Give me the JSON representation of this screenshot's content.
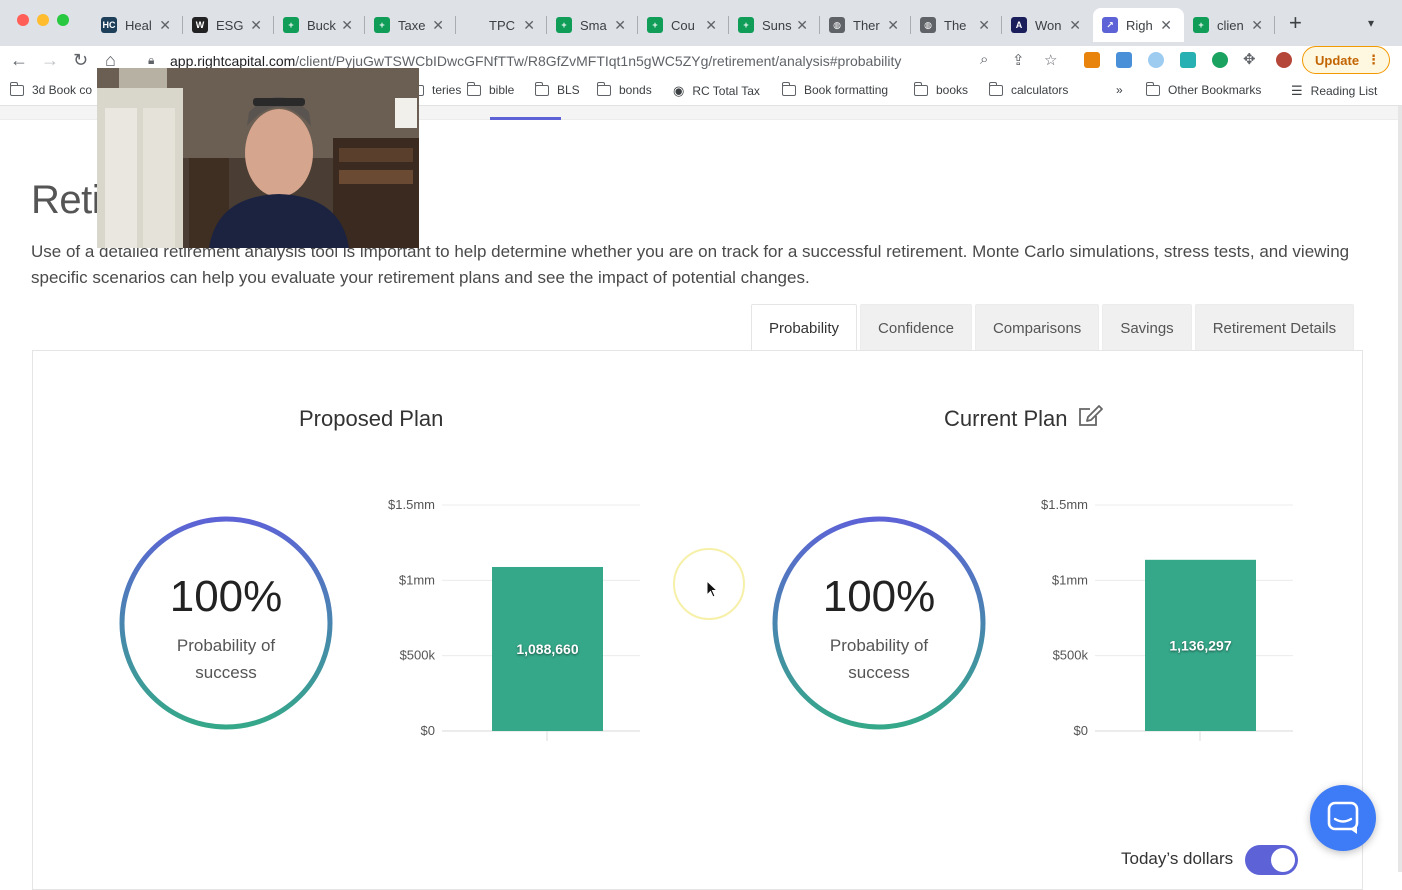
{
  "browser": {
    "tabs": [
      {
        "label": "Heal",
        "fav_text": "HC",
        "fav_color": "#1d3f5a"
      },
      {
        "label": "ESG",
        "fav_text": "W",
        "fav_color": "#222222"
      },
      {
        "label": "Buck",
        "fav_text": "+",
        "fav_color": "#0f9d58"
      },
      {
        "label": "Taxe",
        "fav_text": "+",
        "fav_color": "#0f9d58"
      },
      {
        "label": "TPC",
        "fav_text": "",
        "fav_color": "#dee1e6"
      },
      {
        "label": "Sma",
        "fav_text": "+",
        "fav_color": "#0f9d58"
      },
      {
        "label": "Cou",
        "fav_text": "+",
        "fav_color": "#0f9d58"
      },
      {
        "label": "Suns",
        "fav_text": "+",
        "fav_color": "#0f9d58"
      },
      {
        "label": "Ther",
        "fav_text": "◍",
        "fav_color": "#5f6368"
      },
      {
        "label": "The",
        "fav_text": "◍",
        "fav_color": "#5f6368"
      },
      {
        "label": "Won",
        "fav_text": "A",
        "fav_color": "#1a1f5c"
      },
      {
        "label": "Righ",
        "fav_text": "↗",
        "fav_color": "#5d63d6"
      },
      {
        "label": "clien",
        "fav_text": "+",
        "fav_color": "#0f9d58"
      }
    ],
    "active_tab_index": 11,
    "url_host": "app.rightcapital.com",
    "url_path": "/client/PyjuGwTSWCbIDwcGFNfTTw/R8GfZvMFTIqt1n5gWC5ZYg/retirement/analysis#probability",
    "update_label": "Update",
    "bookmarks": [
      {
        "label": "3d Book co",
        "type": "folder"
      },
      {
        "label": "teries",
        "type": "folder"
      },
      {
        "label": "bible",
        "type": "folder"
      },
      {
        "label": "BLS",
        "type": "folder"
      },
      {
        "label": "bonds",
        "type": "folder"
      },
      {
        "label": "RC Total Tax",
        "type": "globe"
      },
      {
        "label": "Book formatting",
        "type": "folder"
      },
      {
        "label": "books",
        "type": "folder"
      },
      {
        "label": "calculators",
        "type": "folder"
      },
      {
        "label": "»",
        "type": "overflow"
      },
      {
        "label": "Other Bookmarks",
        "type": "folder"
      },
      {
        "label": "Reading List",
        "type": "list"
      }
    ]
  },
  "page": {
    "title": "Reti",
    "description": "Use of a detailed retirement analysis tool is important to help determine whether you are on track for a successful retirement. Monte Carlo simulations, stress tests, and viewing specific scenarios can help you evaluate your retirement plans and see the impact of potential changes.",
    "tabs": [
      "Probability",
      "Confidence",
      "Comparisons",
      "Savings",
      "Retirement Details"
    ],
    "active_tab": "Probability",
    "toggle_label": "Today’s dollars",
    "toggle_on": true
  },
  "plans": [
    {
      "title": "Proposed Plan",
      "probability_pct": "100%",
      "probability_label_1": "Probability of",
      "probability_label_2": "success",
      "bar_label": "1,088,660"
    },
    {
      "title": "Current Plan",
      "probability_pct": "100%",
      "probability_label_1": "Probability of",
      "probability_label_2": "success",
      "bar_label": "1,136,297"
    }
  ],
  "chart_data": [
    {
      "type": "bar",
      "categories": [
        ""
      ],
      "values": [
        1088660
      ],
      "ylim": [
        0,
        1500000
      ],
      "yticks": [
        0,
        500000,
        1000000,
        1500000
      ],
      "ytick_labels": [
        "$0",
        "$500k",
        "$1mm",
        "$1.5mm"
      ],
      "bar_color": "#35a889",
      "grid": true
    },
    {
      "type": "bar",
      "categories": [
        ""
      ],
      "values": [
        1136297
      ],
      "ylim": [
        0,
        1500000
      ],
      "yticks": [
        0,
        500000,
        1000000,
        1500000
      ],
      "ytick_labels": [
        "$0",
        "$500k",
        "$1mm",
        "$1.5mm"
      ],
      "bar_color": "#35a889",
      "grid": true
    }
  ],
  "colors": {
    "accent": "#5d63d6",
    "ring_start": "#5d63d6",
    "ring_end": "#35a889",
    "bar": "#35a889",
    "chat_button": "#3e7bf6"
  }
}
